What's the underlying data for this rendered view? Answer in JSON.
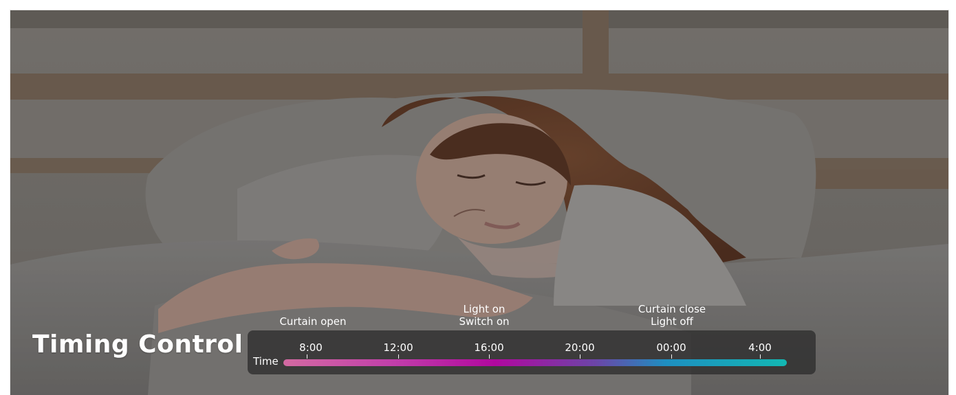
{
  "banner": {
    "title": "Timing Control",
    "time_axis_label": "Time",
    "ticks": [
      "8:00",
      "12:00",
      "16:00",
      "20:00",
      "00:00",
      "4:00"
    ],
    "events": [
      {
        "lines": [
          "Curtain open"
        ]
      },
      {
        "lines": [
          "Light on",
          "Switch on"
        ]
      },
      {
        "lines": [
          "Curtain close",
          "Light off"
        ]
      }
    ],
    "timeline_gradient": [
      "#d36aa2",
      "#b1089f",
      "#6c45a8",
      "#1e8fc1",
      "#13b8b3"
    ]
  }
}
